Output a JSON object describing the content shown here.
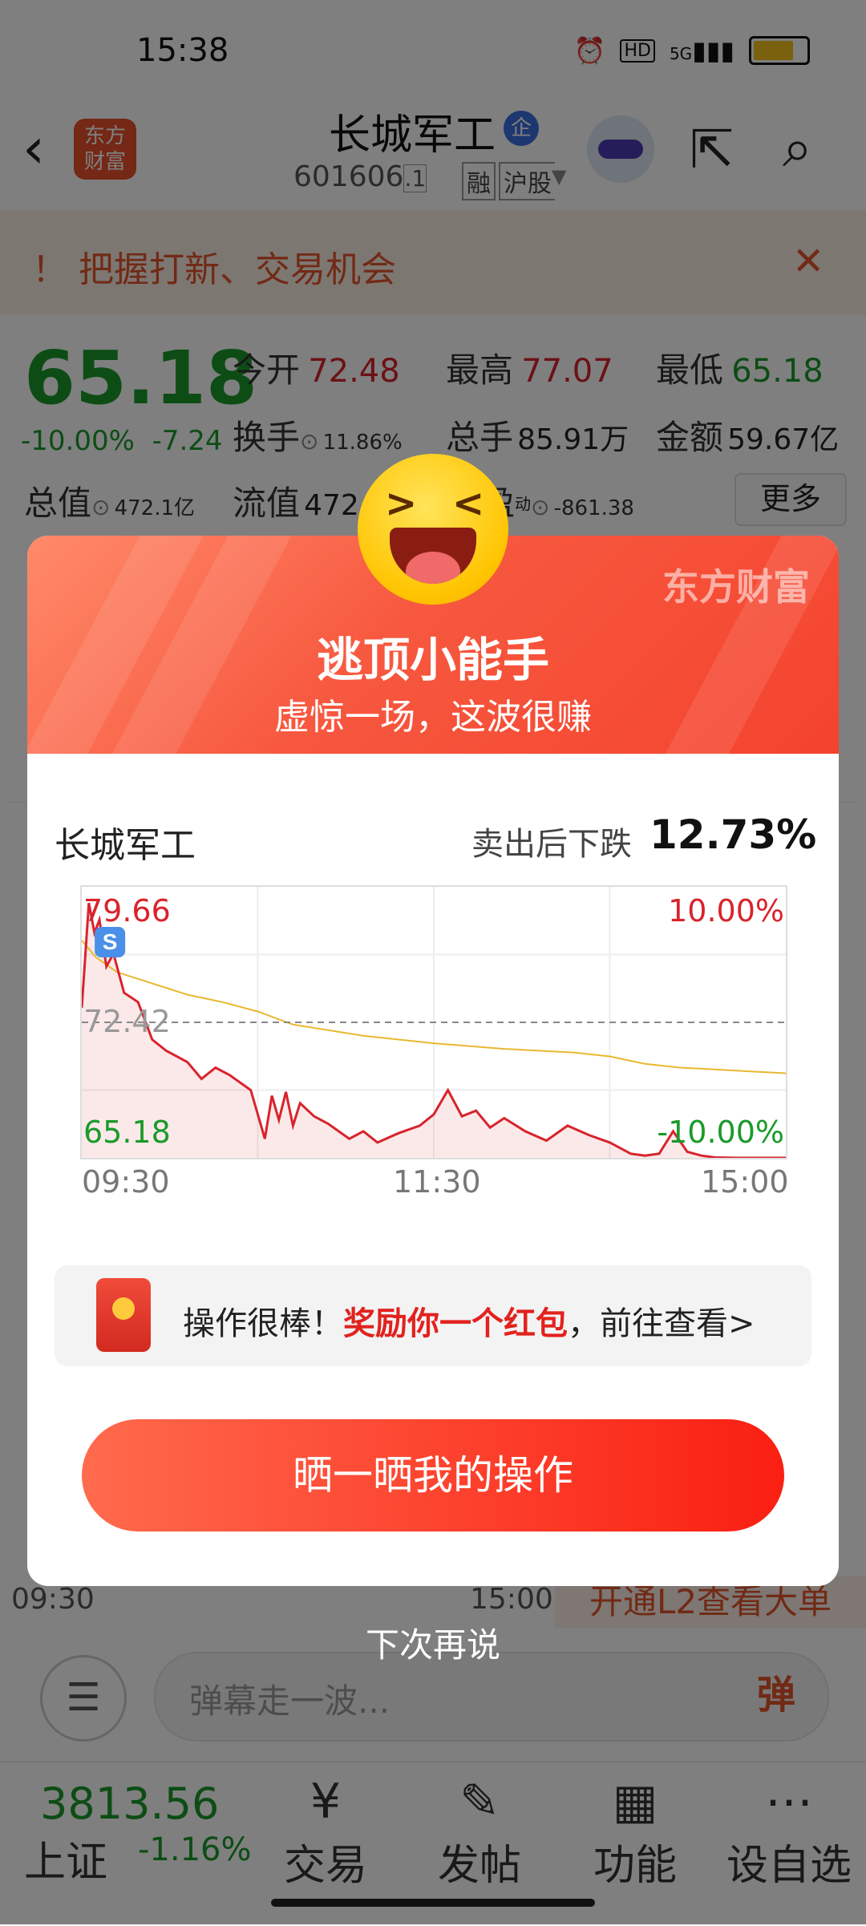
{
  "status_bar": {
    "time": "15:38",
    "network": "5G",
    "hd": "HD"
  },
  "header": {
    "stock_name": "长城军工",
    "qi_badge": "企",
    "stock_code": "601606",
    "code_suffix": ".1",
    "tag_rong": "融",
    "tag_hu": "沪股",
    "app_logo": "东方\n财富",
    "icons": [
      "back-icon",
      "app-logo",
      "robot-avatar",
      "share-icon",
      "search-icon"
    ]
  },
  "notice": {
    "text": "！ 把握打新、交易机会",
    "close": "✕"
  },
  "quote": {
    "price": "65.18",
    "change_pct": "-10.00%",
    "change_abs": "-7.24",
    "open_label": "今开",
    "open": "72.48",
    "high_label": "最高",
    "high": "77.07",
    "low_label": "最低",
    "low": "65.18",
    "turnover_label": "换手",
    "turnover": "11.86%",
    "volume_label": "总手",
    "volume": "85.91万",
    "amount_label": "金额",
    "amount": "59.67亿",
    "mktcap_label": "总值",
    "mktcap": "472.1亿",
    "float_label": "流值",
    "float_val": "472",
    "pe_label": "盈",
    "pe_tag": "动",
    "pe": "-861.38",
    "more_label": "更多"
  },
  "bg_chart": {
    "time_start": "09:30",
    "time_end": "15:00",
    "l2_banner": "开通L2查看大单"
  },
  "comment": {
    "placeholder": "弹幕走一波...",
    "danmu_label": "弹"
  },
  "bottom_nav": {
    "index_value": "3813.56",
    "index_name": "上证",
    "index_change": "-1.16%",
    "items": [
      {
        "label": "交易",
        "icon": "¥"
      },
      {
        "label": "发帖",
        "icon": "✎"
      },
      {
        "label": "功能",
        "icon": "▦"
      },
      {
        "label": "设自选",
        "icon": "⋯"
      }
    ]
  },
  "modal": {
    "brand": "东方财富",
    "title": "逃顶小能手",
    "subtitle": "虚惊一场，这波很赚",
    "stock_name": "长城军工",
    "drop_label": "卖出后下跌",
    "drop_value": "12.73%",
    "reward_prefix": "操作很棒！",
    "reward_highlight": "奖励你一个红包",
    "reward_suffix": "，前往查看>",
    "share_button": "晒一晒我的操作",
    "later": "下次再说"
  },
  "colors": {
    "up_red": "#d9232c",
    "down_green": "#1a9a2a",
    "brand_orange": "#e2542b",
    "avg_line": "#e8b830"
  },
  "chart_data": {
    "type": "line",
    "ylim": [
      65.18,
      79.66
    ],
    "y_left_ticks": [
      "79.66",
      "72.42",
      "65.18"
    ],
    "y_right_ticks": [
      "10.00%",
      "-10.00%"
    ],
    "prev_close": 72.42,
    "x_ticks": [
      "09:30",
      "11:30",
      "15:00"
    ],
    "sell_marker": {
      "label": "S",
      "x": 0.04,
      "y": 78.5
    },
    "series": [
      {
        "x": [
          0,
          0.01,
          0.018,
          0.025,
          0.035,
          0.045,
          0.06,
          0.08,
          0.1,
          0.12,
          0.15,
          0.17,
          0.19,
          0.21,
          0.24,
          0.26,
          0.27,
          0.28,
          0.29,
          0.3,
          0.31,
          0.33,
          0.35,
          0.38,
          0.4,
          0.42,
          0.45,
          0.48,
          0.5,
          0.52,
          0.54,
          0.56,
          0.58,
          0.6,
          0.63,
          0.66,
          0.69,
          0.72,
          0.75,
          0.78,
          0.8,
          0.82,
          0.84,
          0.86,
          0.88,
          0.9,
          0.93,
          0.96,
          1.0
        ],
        "values": [
          73.2,
          78.8,
          77.2,
          77.9,
          75.4,
          76.1,
          74.0,
          73.5,
          71.5,
          70.9,
          70.3,
          69.4,
          70.0,
          69.6,
          68.8,
          66.2,
          68.5,
          67.2,
          68.7,
          66.9,
          68.1,
          67.4,
          67.0,
          66.2,
          66.6,
          66.0,
          66.5,
          66.9,
          67.5,
          68.8,
          67.4,
          67.7,
          66.8,
          67.3,
          66.6,
          66.1,
          66.9,
          66.4,
          66.0,
          65.4,
          65.3,
          65.4,
          66.6,
          65.5,
          65.3,
          65.2,
          65.18,
          65.18,
          65.18
        ]
      },
      {
        "x": [
          0,
          0.02,
          0.05,
          0.1,
          0.15,
          0.2,
          0.25,
          0.3,
          0.4,
          0.5,
          0.6,
          0.7,
          0.75,
          0.8,
          0.85,
          0.9,
          0.95,
          1.0
        ],
        "values": [
          76.8,
          75.9,
          75.1,
          74.5,
          73.9,
          73.5,
          73.0,
          72.3,
          71.7,
          71.3,
          71.0,
          70.8,
          70.6,
          70.2,
          70.0,
          69.9,
          69.8,
          69.7
        ]
      }
    ]
  }
}
